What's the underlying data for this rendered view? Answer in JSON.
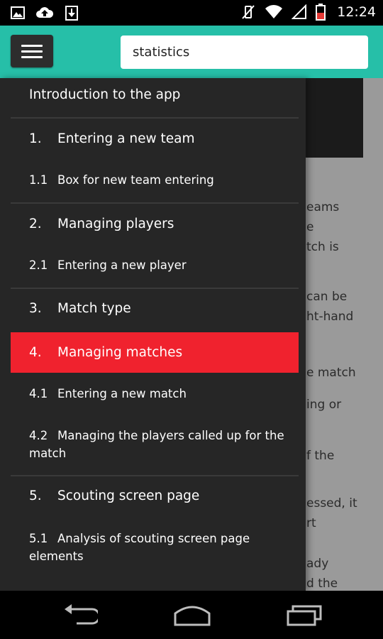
{
  "status_bar": {
    "time": "12:24",
    "left_icons": [
      "image-icon",
      "cloud-upload-icon",
      "download-icon"
    ],
    "right_icons": [
      "vibrate-off-icon",
      "wifi-icon",
      "signal-icon",
      "battery-icon"
    ],
    "battery_color": "#e53935"
  },
  "app_bar": {
    "menu_icon": "hamburger-menu-icon",
    "search_value": "statistics",
    "accent_color": "#26bfa8"
  },
  "background_text": [
    "eams",
    "e",
    "tch is",
    "can be",
    "ht-hand",
    "e match",
    "ing or",
    "f the",
    "essed, it",
    "rt",
    "ady",
    "d the"
  ],
  "drawer": {
    "items": [
      {
        "num": "",
        "label": "Introduction to the app"
      },
      {
        "num": "1.",
        "label": "Entering a new team"
      },
      {
        "num": "1.1",
        "label": "Box for new team entering"
      },
      {
        "num": "2.",
        "label": "Managing players"
      },
      {
        "num": "2.1",
        "label": "Entering a new player"
      },
      {
        "num": "3.",
        "label": "Match type"
      },
      {
        "num": "4.",
        "label": "Managing matches"
      },
      {
        "num": "4.1",
        "label": "Entering a new match"
      },
      {
        "num": "4.2",
        "label": "Managing the players called up for the",
        "label2": "match"
      },
      {
        "num": "5.",
        "label": "Scouting screen page"
      },
      {
        "num": "5.1",
        "label": "Analysis of scouting screen page",
        "label2": "elements"
      }
    ],
    "active_color": "#f0222e"
  },
  "nav_bar": {
    "icons": [
      "back-icon",
      "home-icon",
      "recent-apps-icon"
    ]
  }
}
